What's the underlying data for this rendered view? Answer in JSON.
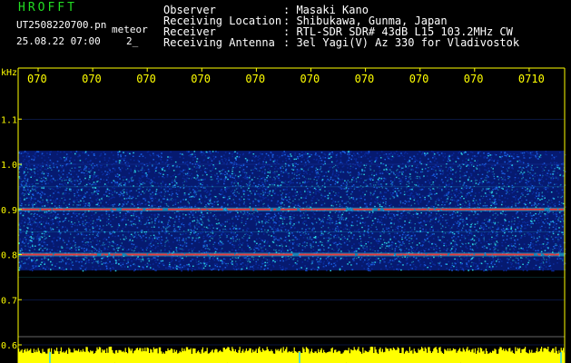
{
  "header": {
    "title": "HROFFT",
    "file_name": "UT2508220700.pn",
    "meteor_label": "meteor",
    "date_time": "25.08.22 07:00",
    "count": "2_"
  },
  "info": [
    {
      "key": "Observer",
      "value": ": Masaki Kano"
    },
    {
      "key": "Receiving Location",
      "value": ": Shibukawa, Gunma, Japan"
    },
    {
      "key": "Receiver",
      "value": ": RTL-SDR SDR# 43dB L15 103.2MHz CW"
    },
    {
      "key": "Receiving Antenna",
      "value": ": 3el Yagi(V) Az 330 for Vladivostok"
    }
  ],
  "chart_data": {
    "type": "heatmap",
    "y_unit": "kHz",
    "y_ticks": [
      "1.1",
      "1.0",
      "0.9",
      "0.8",
      "0.7",
      "0.6"
    ],
    "x_ticks": [
      "070",
      "070",
      "070",
      "070",
      "070",
      "070",
      "070",
      "070",
      "070",
      "0710"
    ],
    "echo_lines_khz": [
      0.9,
      0.8
    ],
    "colors": {
      "background": "#000000",
      "noise_low": "#0a2a9a",
      "noise_mid": "#1a5fe0",
      "noise_high": "#2ad0e0",
      "echo": "#ff3030",
      "grid": "#4488ff",
      "tick_text": "#ffff00",
      "amplitude": "#ffff00"
    }
  }
}
